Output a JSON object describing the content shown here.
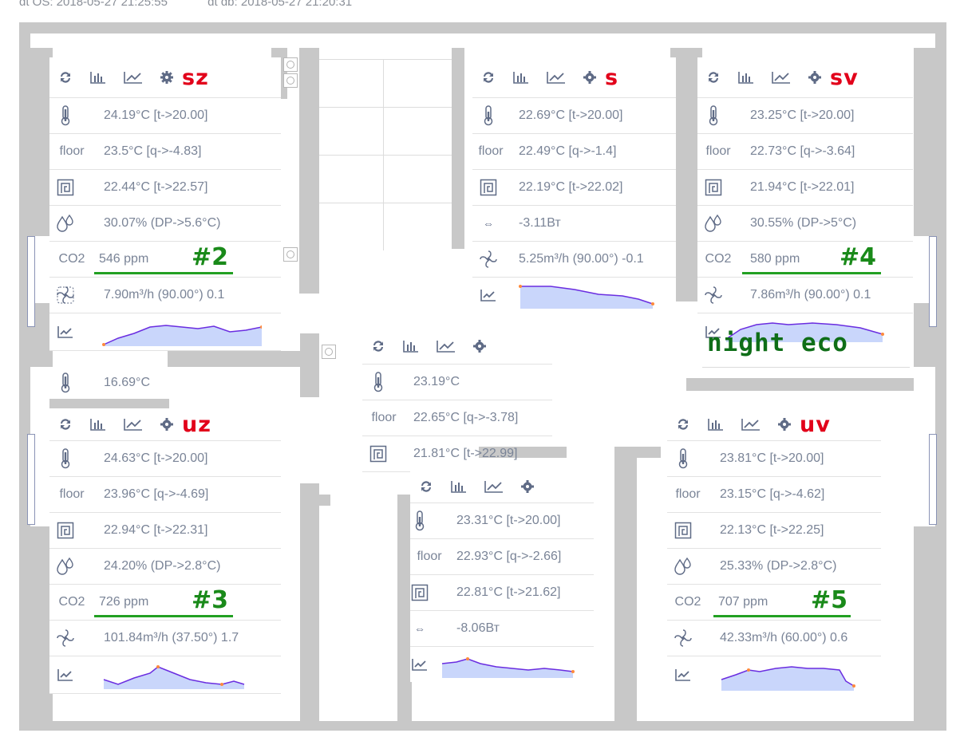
{
  "header": {
    "dt_os": "dt OS: 2018-05-27 21:25:55",
    "dt_db": "dt db: 2018-05-27 21:20:31"
  },
  "labels": {
    "floor": "floor",
    "co2": "CO2",
    "night_eco": "night eco"
  },
  "icons": [
    "refresh-icon",
    "bar-chart-icon",
    "line-chart-icon",
    "gear-icon",
    "thermometer-icon",
    "radiator-icon",
    "humidity-icon",
    "fan-icon",
    "arrows-icon"
  ],
  "colors": {
    "room_name": "#e2001a",
    "badge": "#1a8a1a",
    "night_eco": "#0f6e18",
    "chart_fill": "#c9d6fb",
    "chart_line": "#6a2de0",
    "chart_dot": "#ff8a3c",
    "wall": "#c8c8c8"
  },
  "rooms": {
    "sz": {
      "name": "sz",
      "temp": "24.19°C [t->20.00]",
      "floor": "23.5°C [q->-4.83]",
      "radiator": "22.44°C [t->22.57]",
      "humidity": "30.07% (DP->5.6°C)",
      "co2": "546 ppm",
      "badge": "#2",
      "vent": "7.90m³/h (90.00°) 0.1"
    },
    "s": {
      "name": "s",
      "temp": "22.69°C [t->20.00]",
      "floor": "22.49°C [q->-1.4]",
      "radiator": "22.19°C [t->22.02]",
      "power": "-3.11Вт",
      "vent": "5.25m³/h (90.00°) -0.1"
    },
    "sv": {
      "name": "sv",
      "temp": "23.25°C [t->20.00]",
      "floor": "22.73°C [q->-3.64]",
      "radiator": "21.94°C [t->22.01]",
      "humidity": "30.55% (DP->5°C)",
      "co2": "580 ppm",
      "badge": "#4",
      "vent": "7.86m³/h (90.00°) 0.1"
    },
    "hall_small": {
      "temp": "16.69°C"
    },
    "center": {
      "temp": "23.19°C",
      "floor": "22.65°C [q->-3.78]",
      "radiator": "21.81°C [t->22.99]"
    },
    "uz": {
      "name": "uz",
      "temp": "24.63°C [t->20.00]",
      "floor": "23.96°C [q->-4.69]",
      "radiator": "22.94°C [t->22.31]",
      "humidity": "24.20% (DP->2.8°C)",
      "co2": "726 ppm",
      "badge": "#3",
      "vent": "101.84m³/h (37.50°) 1.7"
    },
    "bath": {
      "temp": "23.31°C [t->20.00]",
      "floor": "22.93°C [q->-2.66]",
      "radiator": "22.81°C [t->21.62]",
      "power": "-8.06Вт"
    },
    "uv": {
      "name": "uv",
      "temp": "23.81°C [t->20.00]",
      "floor": "23.15°C [q->-4.62]",
      "radiator": "22.13°C [t->22.25]",
      "humidity": "25.33% (DP->2.8°C)",
      "co2": "707 ppm",
      "badge": "#5",
      "vent": "42.33m³/h (60.00°) 0.6"
    }
  }
}
